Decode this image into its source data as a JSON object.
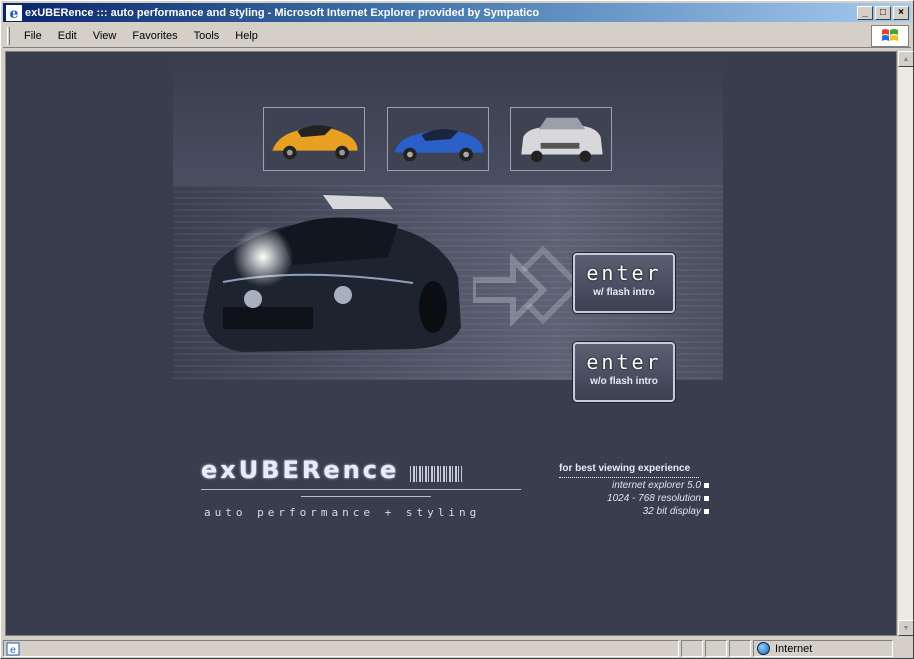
{
  "window": {
    "title": "exUBERence ::: auto performance and styling - Microsoft Internet Explorer provided by Sympatico",
    "minimize_glyph": "_",
    "maximize_glyph": "□",
    "close_glyph": "×"
  },
  "menu": {
    "items": [
      "File",
      "Edit",
      "View",
      "Favorites",
      "Tools",
      "Help"
    ]
  },
  "site": {
    "thumbnails": [
      {
        "label": "orange sports car",
        "color": "#e8a020"
      },
      {
        "label": "blue sports car",
        "color": "#2a60c8"
      },
      {
        "label": "white sedan",
        "color": "#d8d8dc"
      }
    ],
    "enter_flash": {
      "big": "enter",
      "small": "w/ flash intro"
    },
    "enter_noflash": {
      "big": "enter",
      "small": "w/o flash intro"
    },
    "logo": {
      "name": "exUBERence",
      "tagline": "auto performance + styling"
    },
    "viewing": {
      "heading": "for best viewing experience",
      "items": [
        "internet explorer 5.0",
        "1024 - 768 resolution",
        "32 bit display"
      ]
    }
  },
  "status": {
    "zone": "Internet"
  },
  "colors": {
    "page_bg": "#393d4d",
    "titlebar_start": "#0a246a",
    "titlebar_end": "#a6caf0"
  }
}
